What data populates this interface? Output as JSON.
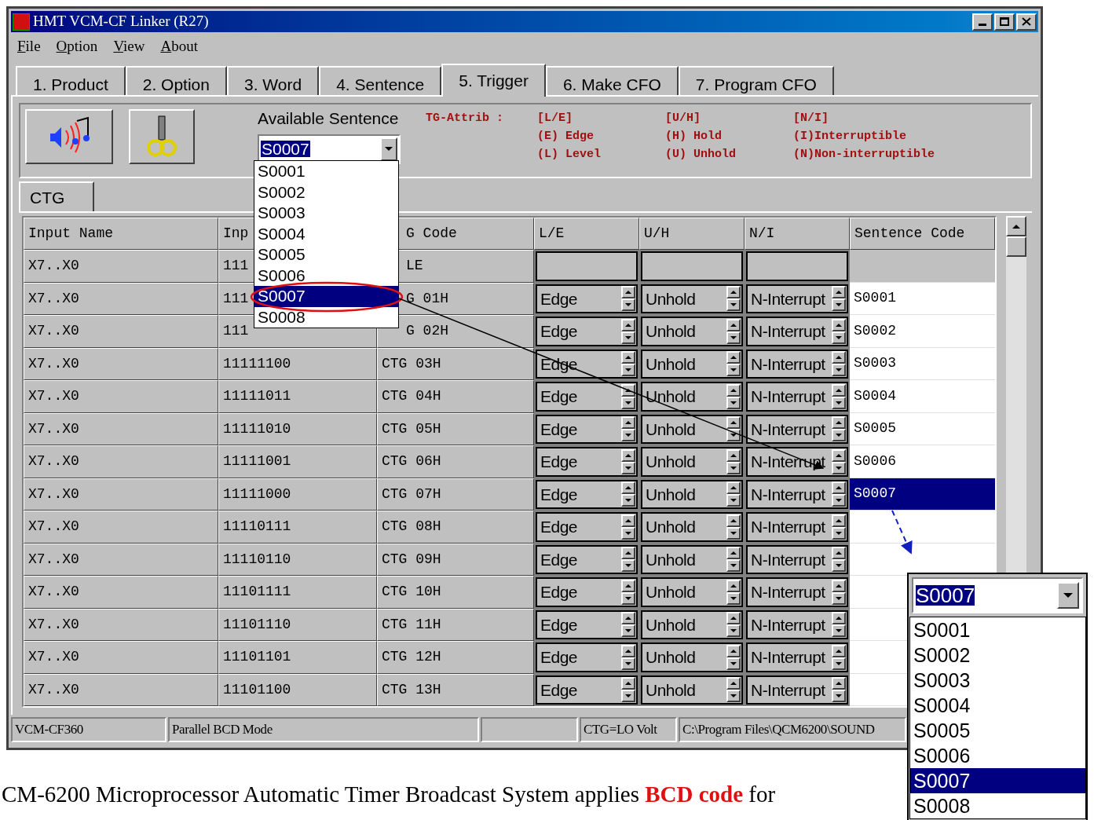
{
  "window": {
    "title": "HMT VCM-CF Linker (R27)"
  },
  "menu": [
    "File",
    "Option",
    "View",
    "About"
  ],
  "tabs": [
    {
      "label": "1. Product",
      "selected": false
    },
    {
      "label": "2. Option",
      "selected": false
    },
    {
      "label": "3. Word",
      "selected": false
    },
    {
      "label": "4. Sentence",
      "selected": false
    },
    {
      "label": "5. Trigger",
      "selected": true
    },
    {
      "label": "6. Make CFO",
      "selected": false
    },
    {
      "label": "7. Program CFO",
      "selected": false
    }
  ],
  "available_sentence": {
    "label": "Available Sentence",
    "value": "S0007",
    "options": [
      {
        "label": "S0001",
        "selected": false
      },
      {
        "label": "S0002",
        "selected": false
      },
      {
        "label": "S0003",
        "selected": false
      },
      {
        "label": "S0004",
        "selected": false
      },
      {
        "label": "S0005",
        "selected": false
      },
      {
        "label": "S0006",
        "selected": false
      },
      {
        "label": "S0007",
        "selected": true
      },
      {
        "label": "S0008",
        "selected": false
      }
    ]
  },
  "legend": {
    "title": "TG-Attrib :",
    "columns": [
      [
        "[L/E]",
        "(E) Edge",
        "(L) Level"
      ],
      [
        "[U/H]",
        "(H) Hold",
        "(U) Unhold"
      ],
      [
        "[N/I]",
        "(I)Interruptible",
        "(N)Non-interruptible"
      ]
    ]
  },
  "subtabs": [
    {
      "label": "CTG",
      "selected": true
    }
  ],
  "grid": {
    "columns": [
      "Input Name",
      "Inp",
      "G Code",
      "L/E",
      "U/H",
      "N/I",
      "Sentence Code"
    ],
    "rows": [
      {
        "kind": "edit",
        "input_name": "X7..X0",
        "input": "111",
        "code": "LE",
        "selected": false
      },
      {
        "kind": "spin",
        "input_name": "X7..X0",
        "input": "111",
        "code": "G 01H",
        "le": "Edge",
        "uh": "Unhold",
        "ni": "N-Interrupt",
        "sentence": "S0001",
        "selected": false
      },
      {
        "kind": "spin",
        "input_name": "X7..X0",
        "input": "111",
        "code": "G 02H",
        "le": "Edge",
        "uh": "Unhold",
        "ni": "N-Interrupt",
        "sentence": "S0002",
        "selected": false
      },
      {
        "kind": "spin",
        "input_name": "X7..X0",
        "input": "11111100",
        "code": "CTG 03H",
        "le": "Edge",
        "uh": "Unhold",
        "ni": "N-Interrupt",
        "sentence": "S0003",
        "selected": false
      },
      {
        "kind": "spin",
        "input_name": "X7..X0",
        "input": "11111011",
        "code": "CTG 04H",
        "le": "Edge",
        "uh": "Unhold",
        "ni": "N-Interrupt",
        "sentence": "S0004",
        "selected": false
      },
      {
        "kind": "spin",
        "input_name": "X7..X0",
        "input": "11111010",
        "code": "CTG 05H",
        "le": "Edge",
        "uh": "Unhold",
        "ni": "N-Interrupt",
        "sentence": "S0005",
        "selected": false
      },
      {
        "kind": "spin",
        "input_name": "X7..X0",
        "input": "11111001",
        "code": "CTG 06H",
        "le": "Edge",
        "uh": "Unhold",
        "ni": "N-Interrupt",
        "sentence": "S0006",
        "selected": false
      },
      {
        "kind": "spin",
        "input_name": "X7..X0",
        "input": "11111000",
        "code": "CTG 07H",
        "le": "Edge",
        "uh": "Unhold",
        "ni": "N-Interrupt",
        "sentence": "S0007",
        "selected": true
      },
      {
        "kind": "spin",
        "input_name": "X7..X0",
        "input": "11110111",
        "code": "CTG 08H",
        "le": "Edge",
        "uh": "Unhold",
        "ni": "N-Interrupt",
        "selected": false
      },
      {
        "kind": "spin",
        "input_name": "X7..X0",
        "input": "11110110",
        "code": "CTG 09H",
        "le": "Edge",
        "uh": "Unhold",
        "ni": "N-Interrupt",
        "selected": false
      },
      {
        "kind": "spin",
        "input_name": "X7..X0",
        "input": "11101111",
        "code": "CTG 10H",
        "le": "Edge",
        "uh": "Unhold",
        "ni": "N-Interrupt",
        "selected": false
      },
      {
        "kind": "spin",
        "input_name": "X7..X0",
        "input": "11101110",
        "code": "CTG 11H",
        "le": "Edge",
        "uh": "Unhold",
        "ni": "N-Interrupt",
        "selected": false
      },
      {
        "kind": "spin",
        "input_name": "X7..X0",
        "input": "11101101",
        "code": "CTG 12H",
        "le": "Edge",
        "uh": "Unhold",
        "ni": "N-Interrupt",
        "selected": false
      },
      {
        "kind": "spin",
        "input_name": "X7..X0",
        "input": "11101100",
        "code": "CTG 13H",
        "le": "Edge",
        "uh": "Unhold",
        "ni": "N-Interrupt",
        "selected": false
      }
    ]
  },
  "status_bar": [
    "VCM-CF360",
    "Parallel BCD Mode",
    "CTG=LO Volt",
    "C:\\Program Files\\QCM6200\\SOUND"
  ],
  "inset_dropdown": {
    "value": "S0007",
    "options": [
      {
        "label": "S0001",
        "selected": false
      },
      {
        "label": "S0002",
        "selected": false
      },
      {
        "label": "S0003",
        "selected": false
      },
      {
        "label": "S0004",
        "selected": false
      },
      {
        "label": "S0005",
        "selected": false
      },
      {
        "label": "S0006",
        "selected": false
      },
      {
        "label": "S0007",
        "selected": true
      },
      {
        "label": "S0008",
        "selected": false
      }
    ]
  },
  "caption": "CM-6200 Microprocessor Automatic Timer Broadcast System applies **BCD code** for"
}
